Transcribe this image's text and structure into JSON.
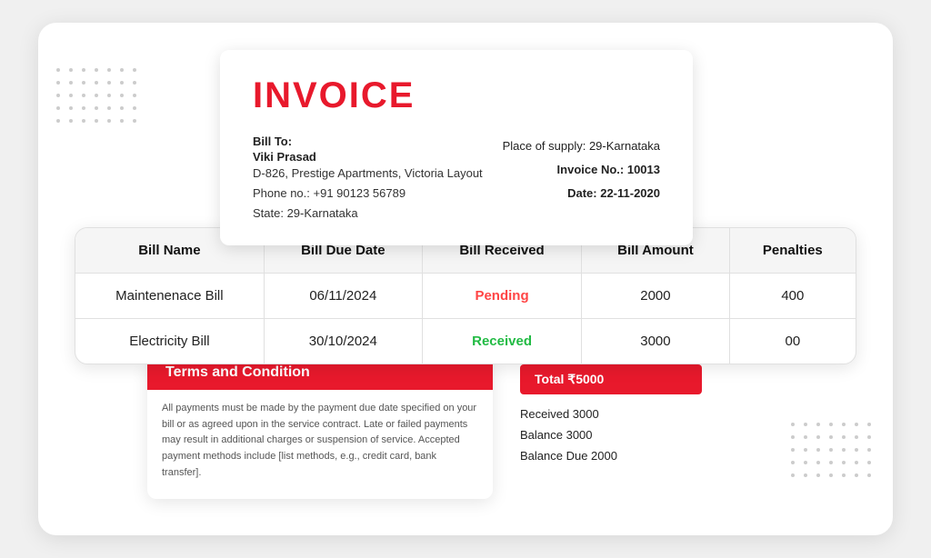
{
  "invoice": {
    "title": "INVOICE",
    "bill_to_label": "Bill To:",
    "bill_to_name": "Viki Prasad",
    "bill_to_address": "D-826, Prestige Apartments, Victoria Layout",
    "bill_to_phone": "Phone no.: +91 90123 56789",
    "bill_to_state": "State: 29-Karnataka",
    "place_of_supply": "Place of supply: 29-Karnataka",
    "invoice_no_label": "Invoice No.: 10013",
    "date_label": "Date: 22-11-2020"
  },
  "table": {
    "headers": [
      "Bill Name",
      "Bill Due Date",
      "Bill Received",
      "Bill Amount",
      "Penalties"
    ],
    "rows": [
      {
        "bill_name": "Maintenenace Bill",
        "due_date": "06/11/2024",
        "received_status": "Pending",
        "received_class": "pending",
        "amount": "2000",
        "penalties": "400"
      },
      {
        "bill_name": "Electricity Bill",
        "due_date": "30/10/2024",
        "received_status": "Received",
        "received_class": "received",
        "amount": "3000",
        "penalties": "00"
      }
    ]
  },
  "terms": {
    "title": "Terms and Condition",
    "text": "All payments must be made by the payment due date specified on your bill or as agreed upon in the service contract. Late or failed payments may result in additional charges or suspension of service. Accepted payment methods include [list methods, e.g., credit card, bank transfer]."
  },
  "summary": {
    "total_label": "Total ₹5000",
    "rows": [
      "Received 3000",
      "Balance 3000",
      "Balance Due 2000"
    ]
  },
  "dots": {
    "count": 35
  }
}
